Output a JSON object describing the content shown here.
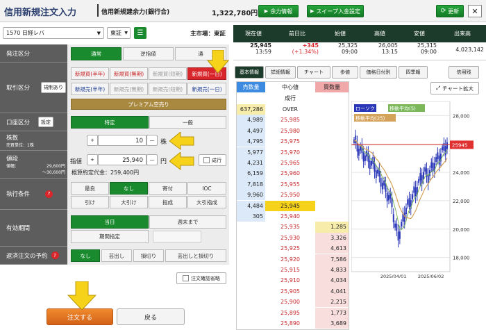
{
  "header": {
    "title": "信用新規注文入力",
    "margin_label": "信用新規建余力(銀行合)",
    "margin_value": "1,322,780円",
    "buttons": {
      "capacity": "余力情報",
      "sweep": "スイープ入金設定",
      "refresh": "更新"
    }
  },
  "stock": {
    "selector": "1570 日経レバ",
    "exchange": "東証",
    "market": "主市場：東証"
  },
  "labels": {
    "order_type": "発注区分",
    "trade_type": "取引区分",
    "account_type": "口座区分",
    "quantity": "株数",
    "quantity_sub": "売買単位：1株",
    "price": "値段",
    "price_range_label": "値幅：",
    "price_range_hi": "29,600円",
    "price_range_lo": "〜30,600円",
    "exec_cond": "執行条件",
    "validity": "有効期間",
    "repay_plan": "返済注文の予約"
  },
  "order_type": {
    "options": [
      "通常",
      "逆指値",
      "通"
    ],
    "selected": "通常"
  },
  "trade": {
    "rule_button": "規制あり",
    "buy_options": [
      "新規買(半年)",
      "新規買(無期)",
      "新規買(短期)",
      "新規買(一日)"
    ],
    "sell_options": [
      "新規売(半年)",
      "新規売(無期)",
      "新規売(短期)",
      "新規売(一日)"
    ],
    "selected": "新規買(一日)",
    "premium": "プレミアム空売り"
  },
  "account": {
    "setting_button": "設定",
    "options": [
      "特定",
      "一般"
    ],
    "selected": "特定"
  },
  "quantity": {
    "value": "10",
    "unit": "株",
    "plus": "+",
    "minus": "—"
  },
  "price": {
    "mode": "指値",
    "value": "25,940",
    "unit": "円",
    "plus": "+",
    "minus": "—",
    "market_order": "成行",
    "estimate_label": "概算約定代金：",
    "estimate_value": "259,400円"
  },
  "exec_cond": {
    "row1": [
      "最良",
      "なし",
      "寄付",
      "IOC"
    ],
    "row2": [
      "引け",
      "大引け",
      "指成",
      "大引指成"
    ],
    "selected": "なし"
  },
  "validity": {
    "row1": [
      "当日",
      "週末まで"
    ],
    "row2": [
      "期間指定"
    ],
    "selected": "当日"
  },
  "repay": {
    "options": [
      "なし",
      "芸出し",
      "損切り",
      "芸出しと損切り"
    ],
    "selected": "なし"
  },
  "confirm_skip": "注文確認省略",
  "submit_button": "注文する",
  "back_button": "戻る",
  "quote": {
    "headers": [
      "現在値",
      "前日比",
      "始値",
      "高値",
      "安値",
      "出来高"
    ],
    "last": "25,945",
    "last_time": "13:59",
    "change": "+345",
    "change_pct": "(+1.34%)",
    "open": "25,325",
    "open_time": "09:00",
    "high": "26,005",
    "high_time": "13:15",
    "low": "25,315",
    "low_time": "09:00",
    "volume": "4,023,142"
  },
  "tabs": [
    "基本情報",
    "詳細情報",
    "チャート",
    "歩値",
    "価格日付別",
    "四季報",
    "信用残"
  ],
  "board": {
    "headers": [
      "売数量",
      "中心値",
      "買数量"
    ],
    "center_label": "成行",
    "over_label": "OVER",
    "sell_rows": [
      [
        "637,286",
        "OVER"
      ],
      [
        "4,989",
        "25,985"
      ],
      [
        "4,497",
        "25,980"
      ],
      [
        "4,795",
        "25,975"
      ],
      [
        "5,977",
        "25,970"
      ],
      [
        "4,231",
        "25,965"
      ],
      [
        "6,159",
        "25,960"
      ],
      [
        "7,818",
        "25,955"
      ],
      [
        "9,960",
        "25,950"
      ],
      [
        "4,484",
        "25,945"
      ],
      [
        "305",
        "25,940"
      ]
    ],
    "buy_rows": [
      [
        "25,935",
        "1,285"
      ],
      [
        "25,930",
        "3,326"
      ],
      [
        "25,925",
        "4,613"
      ],
      [
        "25,920",
        "7,586"
      ],
      [
        "25,915",
        "4,833"
      ],
      [
        "25,910",
        "4,034"
      ],
      [
        "25,905",
        "4,041"
      ],
      [
        "25,900",
        "2,215"
      ],
      [
        "25,895",
        "1,773"
      ],
      [
        "25,890",
        "3,689"
      ]
    ]
  },
  "chart": {
    "expand_button": "チャート拡大",
    "legend": [
      "ローソク",
      "移動平均(5)",
      "移動平均(25)"
    ],
    "y_ticks": [
      "28,000",
      "26,000",
      "24,000",
      "22,000",
      "20,000",
      "18,000"
    ],
    "x_ticks": [
      "2025/04/01",
      "2025/06/02"
    ],
    "last_label": "25945",
    "colors": {
      "candle": "#2a36b8",
      "ma5": "#7ab85a",
      "ma25": "#d4a35a",
      "last": "#e03030"
    }
  }
}
